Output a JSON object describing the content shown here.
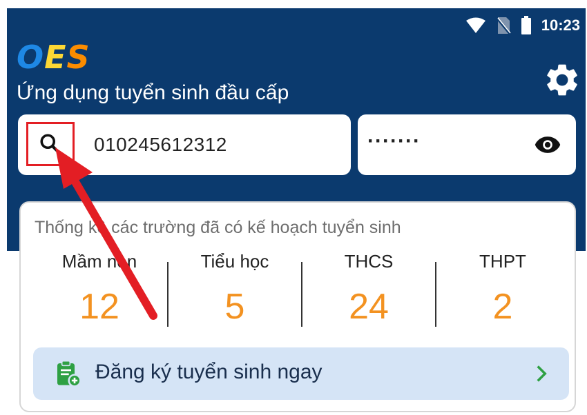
{
  "status_bar": {
    "time": "10:23",
    "icons": [
      "wifi-icon",
      "no-sim-icon",
      "battery-icon"
    ]
  },
  "header": {
    "logo": {
      "letters": [
        "O",
        "E",
        "S"
      ],
      "colors": [
        "#1e88e5",
        "#fdd835",
        "#fb8c00"
      ]
    },
    "subtitle": "Ứng dụng tuyển sinh đầu cấp",
    "settings_icon": "gear-icon",
    "background_color": "#0b3a6e"
  },
  "login": {
    "username_value": "010245612312",
    "password_value": "·······",
    "search_icon": "search-icon",
    "show_password_icon": "eye-icon"
  },
  "stats": {
    "title": "Thống kê các trường đã có kế hoạch tuyển sinh",
    "items": [
      {
        "label": "Mầm non",
        "value": "12"
      },
      {
        "label": "Tiểu học",
        "value": "5"
      },
      {
        "label": "THCS",
        "value": "24"
      },
      {
        "label": "THPT",
        "value": "2"
      }
    ],
    "value_color": "#f39221"
  },
  "register": {
    "label": "Đăng ký tuyển sinh ngay",
    "icon": "clipboard-add-icon",
    "chevron": "chevron-right-icon"
  },
  "annotation": {
    "highlight_color": "#e31e24"
  }
}
